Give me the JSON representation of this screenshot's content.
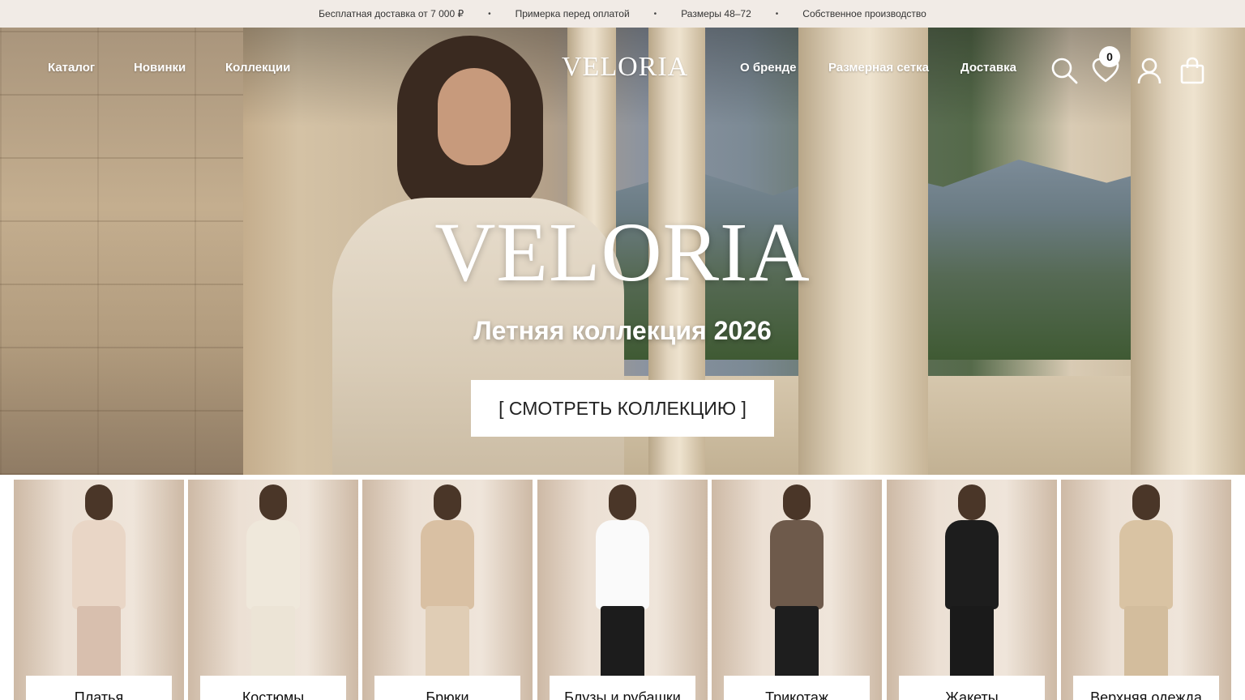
{
  "announcement": {
    "items": [
      "Бесплатная доставка от 7 000 ₽",
      "Примерка перед оплатой",
      "Размеры 48–72",
      "Собственное производство"
    ],
    "separator": "•"
  },
  "header": {
    "nav_left": [
      "Каталог",
      "Новинки",
      "Коллекции"
    ],
    "logo": "VELORIA",
    "nav_right": [
      "О бренде",
      "Размерная сетка",
      "Доставка"
    ],
    "icons": [
      "search-icon",
      "heart-icon",
      "user-icon",
      "bag-icon"
    ],
    "wishlist_count": "0"
  },
  "hero": {
    "title": "VELORIA",
    "subtitle": "Летняя коллекция 2026",
    "cta": "[ СМОТРЕТЬ КОЛЛЕКЦИЮ ]"
  },
  "categories": [
    {
      "label": "Платья",
      "top": "#e9d6c6",
      "bottom": "#d8bfae"
    },
    {
      "label": "Костюмы",
      "top": "#efe8db",
      "bottom": "#ece4d6"
    },
    {
      "label": "Брюки",
      "top": "#d9c0a3",
      "bottom": "#e0cdb5"
    },
    {
      "label": "Блузы и рубашки",
      "top": "#fafafa",
      "bottom": "#1c1c1c"
    },
    {
      "label": "Трикотаж",
      "top": "#6e5a4b",
      "bottom": "#1e1e1e"
    },
    {
      "label": "Жакеты",
      "top": "#1d1d1d",
      "bottom": "#1a1a1a"
    },
    {
      "label": "Верхняя одежда",
      "top": "#d9c3a3",
      "bottom": "#d3bd9d"
    }
  ],
  "colors": {
    "topbar_bg": "#f1ebe6",
    "nav_text": "#ffffff",
    "cta_bg": "#ffffff"
  }
}
